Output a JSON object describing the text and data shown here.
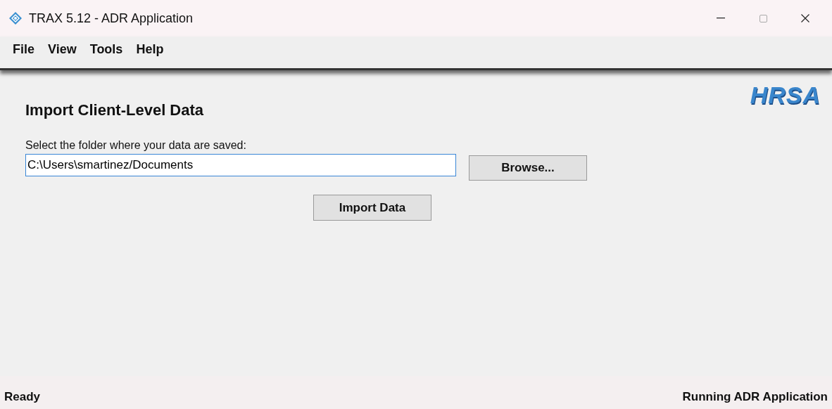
{
  "window": {
    "title": "TRAX 5.12 - ADR Application"
  },
  "menu": [
    "File",
    "View",
    "Tools",
    "Help"
  ],
  "logo": {
    "text": "HRSA"
  },
  "heading": "Import Client-Level Data",
  "folder": {
    "label": "Select the folder where your data are saved:",
    "value": "C:\\Users\\smartinez/Documents",
    "focused": true
  },
  "buttons": {
    "browse": "Browse...",
    "import": "Import Data"
  },
  "status_bar": {
    "left": "Ready",
    "right": "Running ADR Application"
  }
}
